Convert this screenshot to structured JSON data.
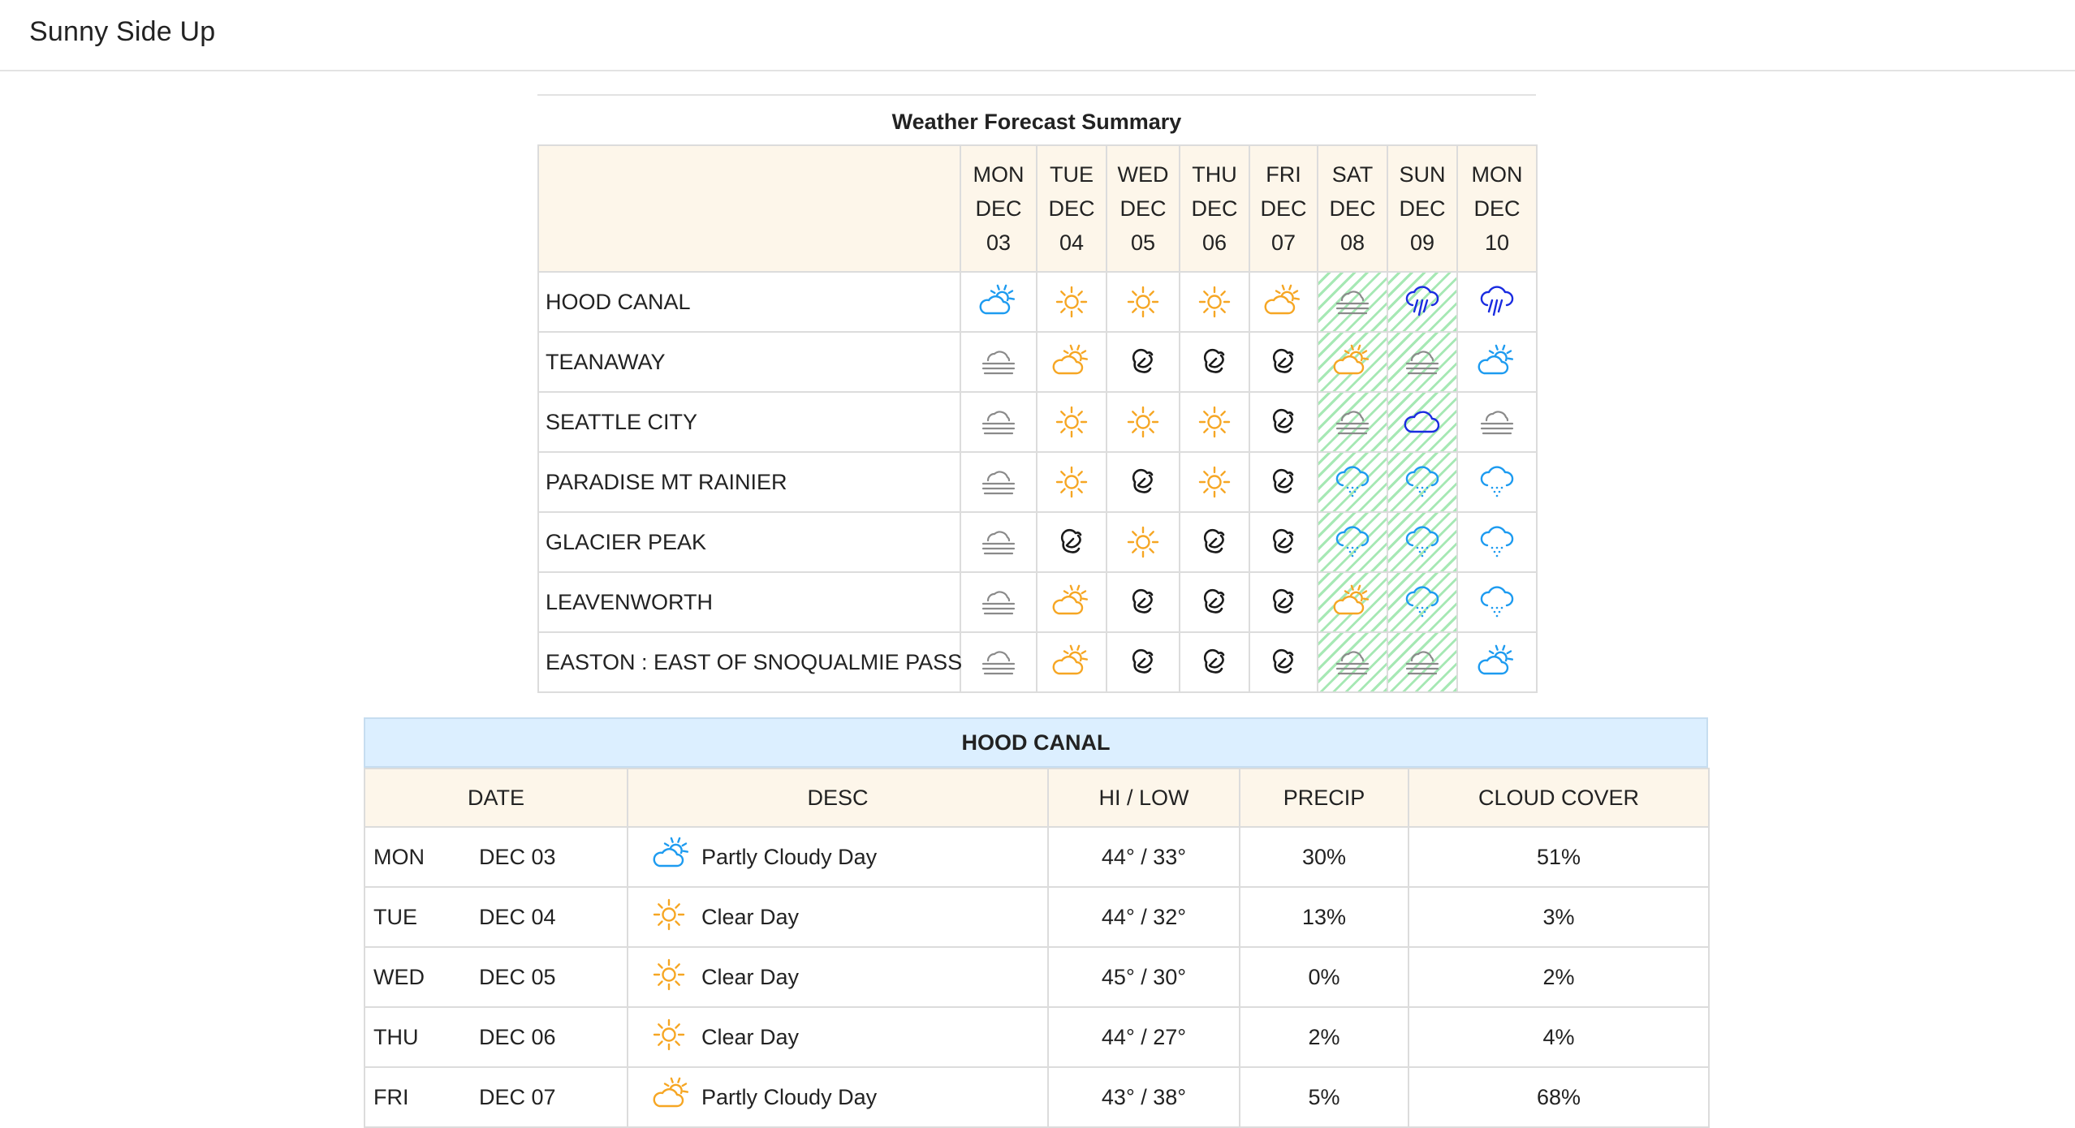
{
  "app": {
    "brand": "Sunny Side Up"
  },
  "colors": {
    "sun": "#f6a623",
    "partly_day": "#1d9bf0",
    "rain": "#1a2ce0",
    "fog": "#8a8a8a",
    "header_bg": "#fdf6ea",
    "detail_title_bg": "#dcefff",
    "weekend_hatch": "#a6e8b4"
  },
  "summary": {
    "title": "Weather Forecast Summary",
    "days": [
      {
        "dow": "MON",
        "mon": "DEC",
        "day": "03",
        "weekend": false
      },
      {
        "dow": "TUE",
        "mon": "DEC",
        "day": "04",
        "weekend": false
      },
      {
        "dow": "WED",
        "mon": "DEC",
        "day": "05",
        "weekend": false
      },
      {
        "dow": "THU",
        "mon": "DEC",
        "day": "06",
        "weekend": false
      },
      {
        "dow": "FRI",
        "mon": "DEC",
        "day": "07",
        "weekend": false
      },
      {
        "dow": "SAT",
        "mon": "DEC",
        "day": "08",
        "weekend": true
      },
      {
        "dow": "SUN",
        "mon": "DEC",
        "day": "09",
        "weekend": true
      },
      {
        "dow": "MON",
        "mon": "DEC",
        "day": "10",
        "weekend": false
      }
    ],
    "rows": [
      {
        "location": "HOOD CANAL",
        "icons": [
          "partly-cloudy-day-icon-blue",
          "clear-day-icon",
          "clear-day-icon",
          "clear-day-icon",
          "partly-cloudy-day-icon",
          "fog-icon",
          "rain-icon",
          "rain-icon"
        ]
      },
      {
        "location": "TEANAWAY",
        "icons": [
          "fog-icon",
          "partly-cloudy-day-icon",
          "wind-icon",
          "wind-icon",
          "wind-icon",
          "partly-cloudy-day-icon",
          "fog-icon",
          "partly-cloudy-day-icon-blue"
        ]
      },
      {
        "location": "SEATTLE CITY",
        "icons": [
          "fog-icon",
          "clear-day-icon",
          "clear-day-icon",
          "clear-day-icon",
          "wind-icon",
          "fog-icon",
          "cloudy-icon",
          "fog-icon"
        ]
      },
      {
        "location": "PARADISE MT RAINIER",
        "icons": [
          "fog-icon",
          "clear-day-icon",
          "wind-icon",
          "clear-day-icon",
          "wind-icon",
          "snow-icon",
          "snow-icon",
          "snow-icon"
        ]
      },
      {
        "location": "GLACIER PEAK",
        "icons": [
          "fog-icon",
          "wind-icon",
          "clear-day-icon",
          "wind-icon",
          "wind-icon",
          "snow-icon",
          "snow-icon",
          "snow-icon"
        ]
      },
      {
        "location": "LEAVENWORTH",
        "icons": [
          "fog-icon",
          "partly-cloudy-day-icon",
          "wind-icon",
          "wind-icon",
          "wind-icon",
          "partly-cloudy-day-icon",
          "snow-icon",
          "snow-icon"
        ]
      },
      {
        "location": "EASTON : EAST OF SNOQUALMIE PASS",
        "icons": [
          "fog-icon",
          "partly-cloudy-day-icon",
          "wind-icon",
          "wind-icon",
          "wind-icon",
          "fog-icon",
          "fog-icon",
          "partly-cloudy-day-icon-blue"
        ]
      }
    ]
  },
  "detail": {
    "title": "HOOD CANAL",
    "headers": {
      "date": "DATE",
      "desc": "DESC",
      "hilow": "HI / LOW",
      "precip": "PRECIP",
      "cloud": "CLOUD COVER"
    },
    "rows": [
      {
        "dow": "MON",
        "date": "DEC 03",
        "icon": "partly-cloudy-day-icon-blue",
        "desc": "Partly Cloudy Day",
        "hilow": "44° / 33°",
        "precip": "30%",
        "cloud": "51%"
      },
      {
        "dow": "TUE",
        "date": "DEC 04",
        "icon": "clear-day-icon",
        "desc": "Clear Day",
        "hilow": "44° / 32°",
        "precip": "13%",
        "cloud": "3%"
      },
      {
        "dow": "WED",
        "date": "DEC 05",
        "icon": "clear-day-icon",
        "desc": "Clear Day",
        "hilow": "45° / 30°",
        "precip": "0%",
        "cloud": "2%"
      },
      {
        "dow": "THU",
        "date": "DEC 06",
        "icon": "clear-day-icon",
        "desc": "Clear Day",
        "hilow": "44° / 27°",
        "precip": "2%",
        "cloud": "4%"
      },
      {
        "dow": "FRI",
        "date": "DEC 07",
        "icon": "partly-cloudy-day-icon",
        "desc": "Partly Cloudy Day",
        "hilow": "43° / 38°",
        "precip": "5%",
        "cloud": "68%"
      }
    ]
  }
}
